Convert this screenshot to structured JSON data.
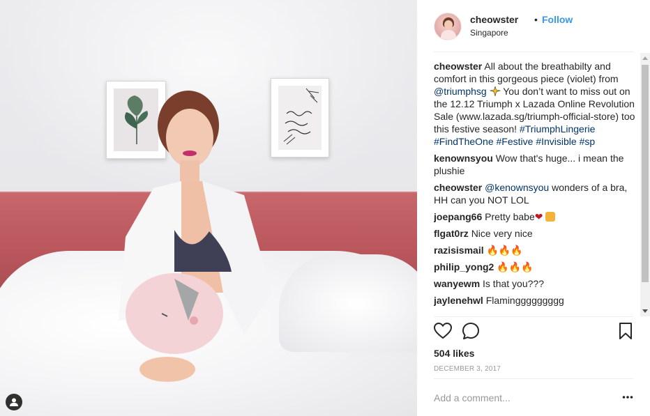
{
  "post": {
    "user_tag_icon": "user-tag-icon"
  },
  "header": {
    "username": "cheowster",
    "separator": "•",
    "follow_label": "Follow",
    "location": "Singapore"
  },
  "caption": {
    "username": "cheowster",
    "text_1": "All about the breathabilty and comfort in this gorgeous piece (violet) from",
    "mention": "@triumphsg",
    "text_2": "You don’t want to miss out on the 12.12 Triumph x Lazada Online Revolution Sale (www.lazada.sg/triumph-official-store) too this festive season!",
    "hashtags": [
      "#TriumphLingerie",
      "#FindTheOne",
      "#Festive",
      "#Invisible",
      "#sp"
    ]
  },
  "comments": [
    {
      "username": "kenownsyou",
      "text": "Wow that's huge... i mean the plushie"
    },
    {
      "username": "cheowster",
      "mention": "@kenownsyou",
      "text": "wonders of a bra, HH can you NOT LOL"
    },
    {
      "username": "joepang66",
      "text": "Pretty babe",
      "emoji": "heart-and-girl"
    },
    {
      "username": "flgat0rz",
      "text": "Nice very nice"
    },
    {
      "username": "razisismail",
      "emoji": "fire-fire-fire"
    },
    {
      "username": "philip_yong2",
      "emoji": "fire-fire-fire"
    },
    {
      "username": "wanyewm",
      "text": "Is that you???"
    },
    {
      "username": "jaylenehwl",
      "text": "Flaminggggggggg"
    }
  ],
  "actions": {
    "like_icon": "heart-outline-icon",
    "comment_icon": "comment-bubble-icon",
    "save_icon": "bookmark-icon"
  },
  "likes_text": "504 likes",
  "date_text": "DECEMBER 3, 2017",
  "add_comment": {
    "placeholder": "Add a comment..."
  },
  "more_icon": "ellipsis-icon",
  "colors": {
    "link": "#3897f0",
    "mention": "#003569",
    "headboard": "#b8565c"
  }
}
